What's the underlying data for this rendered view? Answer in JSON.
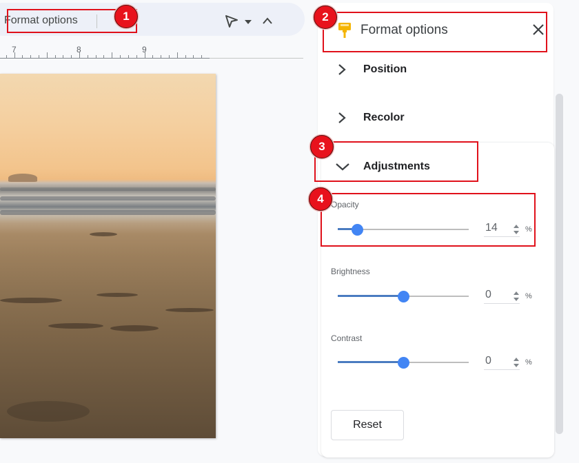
{
  "toolbar": {
    "label": "Format options",
    "icons": [
      "select-cursor-icon",
      "caret-down-icon",
      "chevron-up-icon"
    ]
  },
  "ruler": {
    "numbers": [
      "7",
      "8",
      "9"
    ]
  },
  "image": {
    "description": "Beach at sunset with waves and footprints in the sand"
  },
  "panel": {
    "title": "Format options",
    "header_icon": "paint-roller-icon",
    "close_icon": "close-icon",
    "sections": [
      {
        "label": "Position",
        "expanded": false
      },
      {
        "label": "Recolor",
        "expanded": false
      },
      {
        "label": "Adjustments",
        "expanded": true
      }
    ],
    "adjustments": {
      "opacity": {
        "label": "Opacity",
        "value": "14",
        "unit": "%",
        "fraction": 0.14
      },
      "brightness": {
        "label": "Brightness",
        "value": "0",
        "unit": "%",
        "fraction": 0.5
      },
      "contrast": {
        "label": "Contrast",
        "value": "0",
        "unit": "%",
        "fraction": 0.5
      }
    },
    "reset_label": "Reset"
  },
  "annotations": [
    {
      "number": "1",
      "target": "toolbar format options"
    },
    {
      "number": "2",
      "target": "panel header"
    },
    {
      "number": "3",
      "target": "adjustments section"
    },
    {
      "number": "4",
      "target": "opacity control"
    }
  ],
  "colors": {
    "accent": "#4285f4",
    "annotation": "#e0101a"
  }
}
